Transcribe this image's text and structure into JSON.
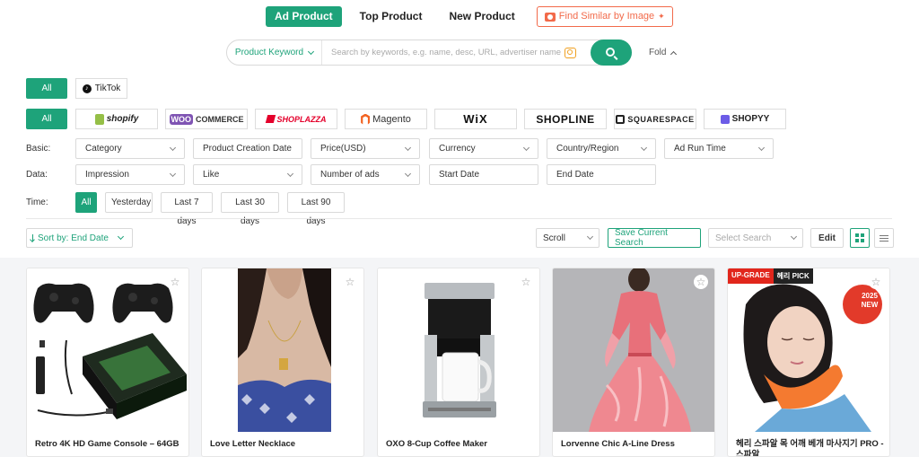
{
  "nav": {
    "tabs": [
      "Ad Product",
      "Top Product",
      "New Product"
    ],
    "image_search": "Find Similar by Image",
    "accent_color": "#1ea37a",
    "image_search_color": "#f26a4a"
  },
  "search": {
    "keyword_select": "Product Keyword",
    "placeholder": "Search by keywords, e.g. name, desc, URL, advertiser name",
    "fold": "Fold"
  },
  "filters": {
    "all": "All",
    "platform": "TikTok",
    "stores": [
      "shopify",
      "WOO",
      "COMMERCE",
      "SHOPLAZZA",
      "Magento",
      "WiX",
      "SHOPLINE",
      "SQUARESPACE",
      "SHOPYY"
    ],
    "basic_label": "Basic:",
    "basic": [
      "Category",
      "Product Creation Date",
      "Price(USD)",
      "Currency",
      "Country/Region",
      "Ad Run Time"
    ],
    "data_label": "Data:",
    "data": [
      "Impression",
      "Like",
      "Number of ads",
      "Start Date",
      "End Date"
    ],
    "time_label": "Time:",
    "time": [
      "All",
      "Yesterday",
      "Last 7 days",
      "Last 30 days",
      "Last 90 days"
    ]
  },
  "toolbar": {
    "sort": "Sort by: End Date",
    "scroll": "Scroll",
    "save": "Save Current Search",
    "select_search": "Select Search",
    "edit": "Edit"
  },
  "products": [
    {
      "title": "Retro 4K HD Game Console – 64GB"
    },
    {
      "title": "Love Letter Necklace"
    },
    {
      "title": "OXO 8-Cup Coffee Maker"
    },
    {
      "title": "Lorvenne Chic A-Line Dress"
    },
    {
      "title": "헤리 스파알 목 어깨 베개 마사지기 PRO - 스파알",
      "badges": [
        "UP-GRADE",
        "헤리 PICK"
      ],
      "tag": "2025 NEW"
    }
  ]
}
